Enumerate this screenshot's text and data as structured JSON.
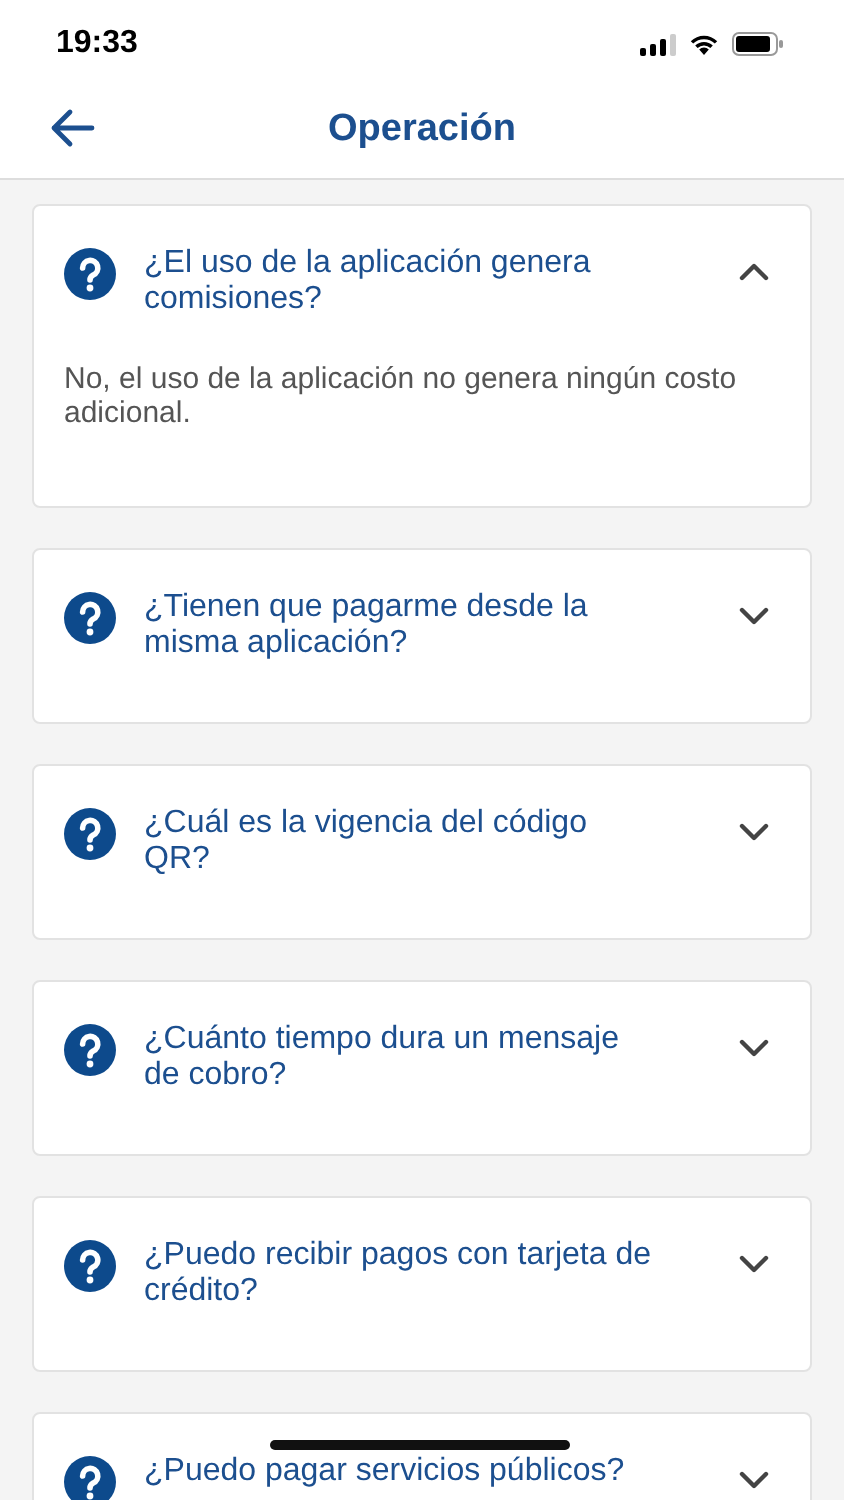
{
  "status_bar": {
    "time": "19:33"
  },
  "header": {
    "title": "Operación"
  },
  "faqs": [
    {
      "question": "¿El uso de la aplicación genera comisiones?",
      "expanded": true,
      "answer": "No, el uso de la aplicación no genera ningún costo adicional."
    },
    {
      "question": "¿Tienen que pagarme desde la misma aplicación?",
      "expanded": false
    },
    {
      "question": "¿Cuál es la vigencia del código QR?",
      "expanded": false
    },
    {
      "question": "¿Cuánto tiempo dura un mensaje de cobro?",
      "expanded": false
    },
    {
      "question": "¿Puedo recibir pagos con tarjeta de crédito?",
      "expanded": false
    },
    {
      "question": "¿Puedo pagar servicios públicos?",
      "expanded": false
    }
  ]
}
